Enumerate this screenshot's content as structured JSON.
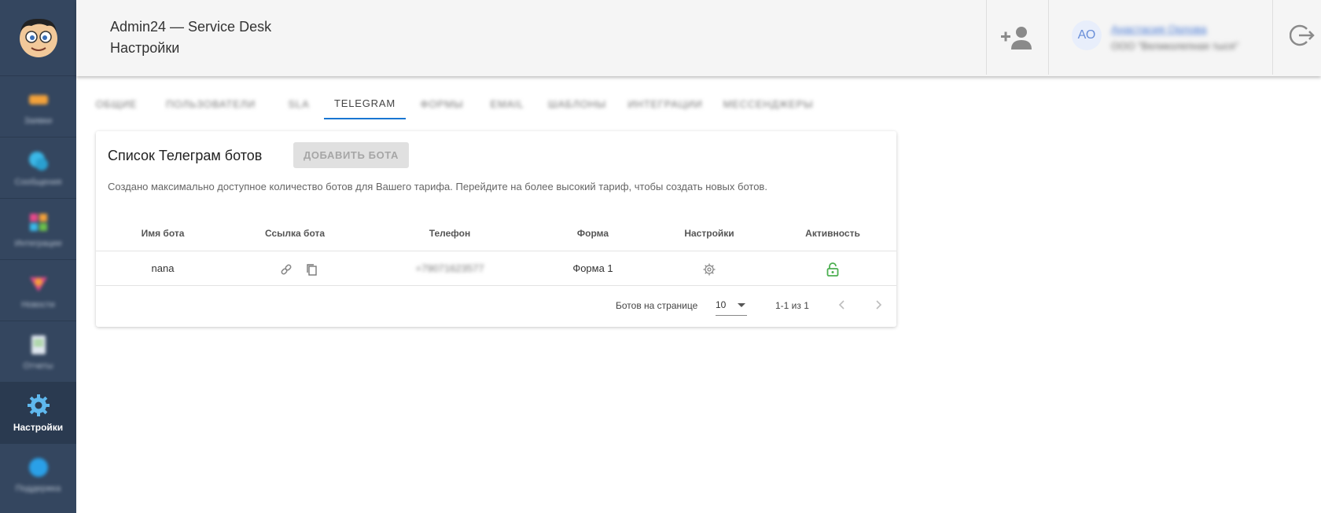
{
  "app": {
    "title": "Admin24 — Service Desk",
    "section": "Настройки"
  },
  "sidebar": {
    "items": [
      {
        "label": "Заявки",
        "icon": "tickets-icon"
      },
      {
        "label": "Сообщения",
        "icon": "messages-icon"
      },
      {
        "label": "Интеграции",
        "icon": "integrations-icon"
      },
      {
        "label": "Новости",
        "icon": "news-icon"
      },
      {
        "label": "Отчеты",
        "icon": "reports-icon"
      },
      {
        "label": "Настройки",
        "icon": "gear-icon",
        "active": true
      },
      {
        "label": "Поддержка",
        "icon": "support-icon"
      }
    ]
  },
  "header": {
    "avatar_initials": "АО",
    "user_name": "Анастасия Орлова",
    "user_org": "ООО \"Великолепная тыся\""
  },
  "tabs": [
    {
      "label": "ОБЩИЕ",
      "blurred": true
    },
    {
      "label": "ПОЛЬЗОВАТЕЛИ",
      "blurred": true
    },
    {
      "label": "SLA",
      "blurred": true
    },
    {
      "label": "TELEGRAM",
      "active": true
    },
    {
      "label": "ФОРМЫ",
      "blurred": true
    },
    {
      "label": "EMAIL",
      "blurred": true
    },
    {
      "label": "ШАБЛОНЫ",
      "blurred": true
    },
    {
      "label": "ИНТЕГРАЦИИ",
      "blurred": true
    },
    {
      "label": "МЕССЕНДЖЕРЫ",
      "blurred": true
    }
  ],
  "card": {
    "title": "Список Телеграм ботов",
    "add_button": "ДОБАВИТЬ БОТА",
    "notice": "Создано максимально доступное количество ботов для Вашего тарифа. Перейдите на более высокий тариф, чтобы создать новых ботов."
  },
  "table": {
    "headers": [
      "Имя бота",
      "Ссылка бота",
      "Телефон",
      "Форма",
      "Настройки",
      "Активность"
    ],
    "rows": [
      {
        "name": "nana",
        "phone": "+79071623577",
        "form": "Форма 1"
      }
    ]
  },
  "pagination": {
    "per_page_label": "Ботов на странице",
    "per_page_value": "10",
    "range": "1-1 из 1"
  },
  "colors": {
    "sidebar_bg": "#34465f",
    "tab_accent": "#1976d2",
    "active_lock": "#4caf50"
  }
}
